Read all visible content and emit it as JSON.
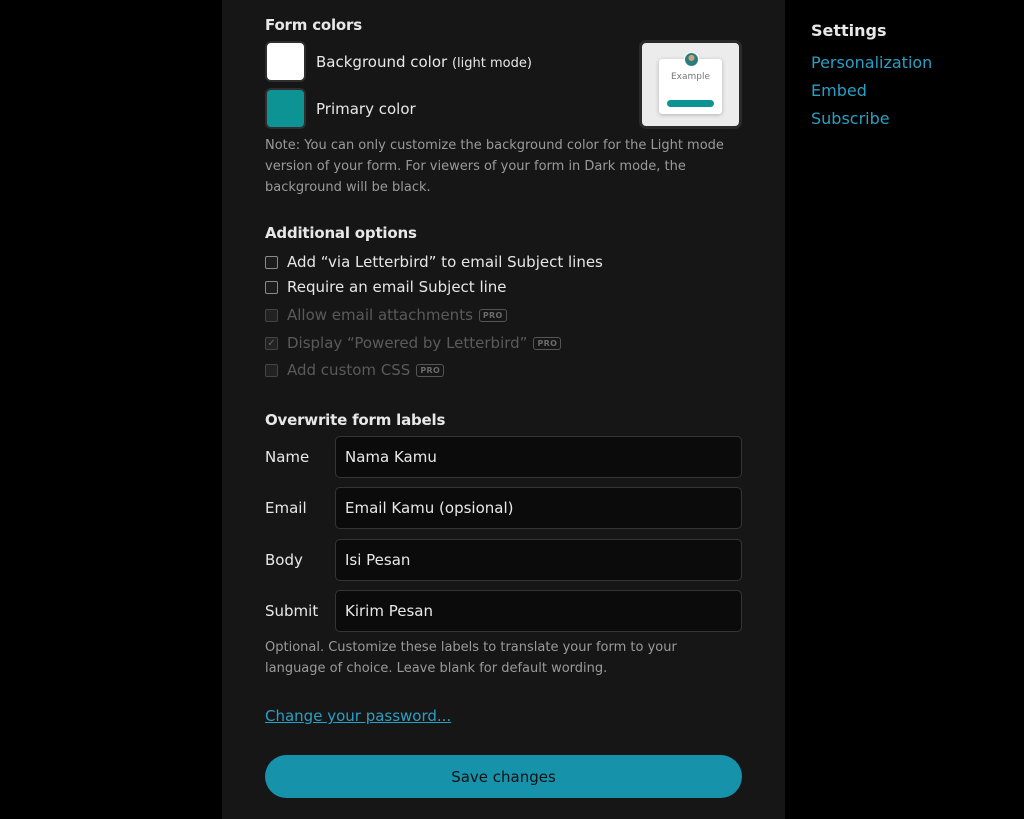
{
  "form_colors": {
    "heading": "Form colors",
    "background": {
      "label": "Background color",
      "qualifier": "(light mode)",
      "color": "#ffffff"
    },
    "primary": {
      "label": "Primary color",
      "color": "#0d9393"
    },
    "preview_text": "Example",
    "note": "Note: You can only customize the background color for the Light mode version of your form. For viewers of your form in Dark mode, the background will be black."
  },
  "additional_options": {
    "heading": "Additional options",
    "options": [
      {
        "label": "Add “via Letterbird” to email Subject lines",
        "checked": false,
        "disabled": false,
        "pro": ""
      },
      {
        "label": "Require an email Subject line",
        "checked": false,
        "disabled": false,
        "pro": ""
      },
      {
        "label": "Allow email attachments",
        "checked": false,
        "disabled": true,
        "pro": "PRO"
      },
      {
        "label": "Display “Powered by Letterbird”",
        "checked": true,
        "disabled": true,
        "pro": "PRO"
      },
      {
        "label": "Add custom CSS",
        "checked": false,
        "disabled": true,
        "pro": "PRO"
      }
    ]
  },
  "overwrite_labels": {
    "heading": "Overwrite form labels",
    "fields": [
      {
        "label": "Name",
        "value": "Nama Kamu"
      },
      {
        "label": "Email",
        "value": "Email Kamu (opsional)"
      },
      {
        "label": "Body",
        "value": "Isi Pesan"
      },
      {
        "label": "Submit",
        "value": "Kirim Pesan"
      }
    ],
    "note": "Optional. Customize these labels to translate your form to your language of choice. Leave blank for default wording."
  },
  "change_password_link": "Change your password...",
  "save_button": "Save changes",
  "sidebar": {
    "title": "Settings",
    "links": [
      "Personalization",
      "Embed",
      "Subscribe"
    ]
  }
}
